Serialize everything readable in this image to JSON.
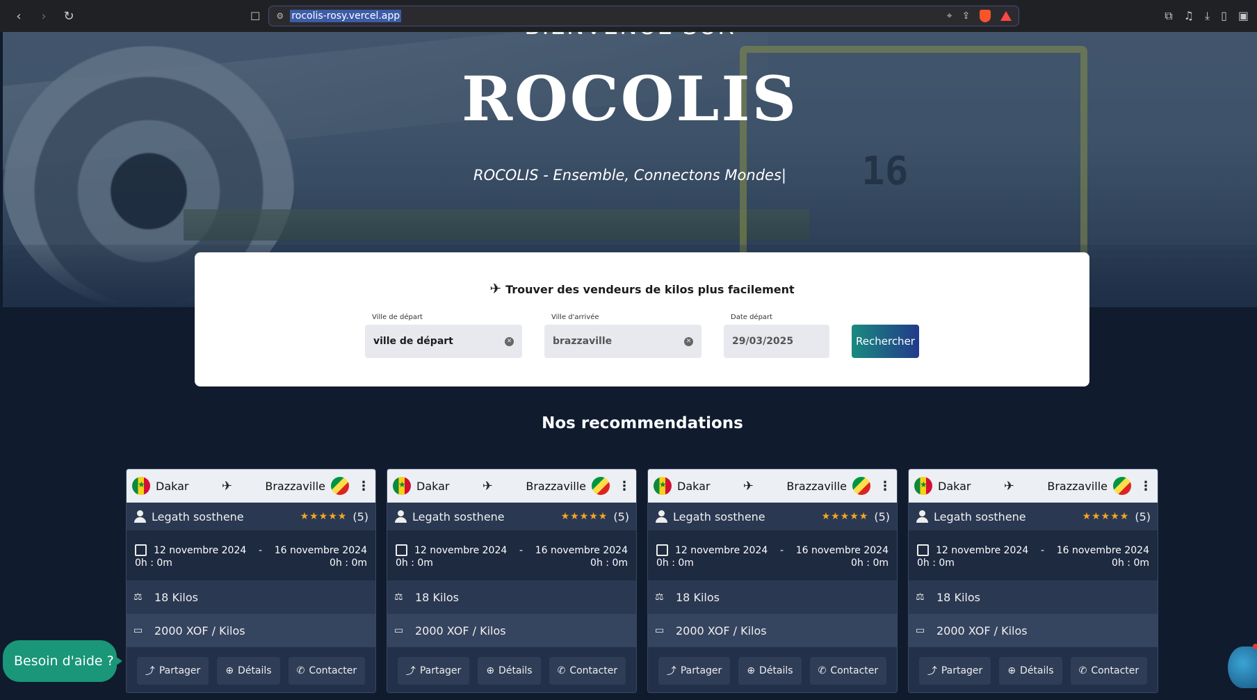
{
  "browser": {
    "url": "rocolis-rosy.vercel.app",
    "nav": {
      "back": "‹",
      "forward": "›",
      "reload": "↻"
    }
  },
  "hero": {
    "heading_top": "BIENVENUE SUR",
    "brand": "ROCOLIS",
    "tagline": "ROCOLIS - Ensemble, Connectons Mondes|"
  },
  "search": {
    "title": "Trouver des vendeurs de kilos plus facilement",
    "departure": {
      "label": "Ville de départ",
      "value": "ville de départ"
    },
    "arrival": {
      "label": "Ville d'arrivée",
      "value": "brazzaville"
    },
    "date": {
      "label": "Date départ",
      "value": "29/03/2025"
    },
    "submit_label": "Rechercher"
  },
  "recommendations": {
    "title": "Nos recommendations",
    "cards": [
      {
        "from": "Dakar",
        "to": "Brazzaville",
        "seller": "Legath sosthene",
        "stars": "★★★★★",
        "rating_count": "(5)",
        "start_date": "12 novembre 2024",
        "end_date": "16 novembre 2024",
        "start_time": "0h : 0m",
        "end_time": "0h : 0m",
        "weight": "18 Kilos",
        "price": "2000 XOF / Kilos",
        "share": "Partager",
        "details": "Détails",
        "contact": "Contacter"
      },
      {
        "from": "Dakar",
        "to": "Brazzaville",
        "seller": "Legath sosthene",
        "stars": "★★★★★",
        "rating_count": "(5)",
        "start_date": "12 novembre 2024",
        "end_date": "16 novembre 2024",
        "start_time": "0h : 0m",
        "end_time": "0h : 0m",
        "weight": "18 Kilos",
        "price": "2000 XOF / Kilos",
        "share": "Partager",
        "details": "Détails",
        "contact": "Contacter"
      },
      {
        "from": "Dakar",
        "to": "Brazzaville",
        "seller": "Legath sosthene",
        "stars": "★★★★★",
        "rating_count": "(5)",
        "start_date": "12 novembre 2024",
        "end_date": "16 novembre 2024",
        "start_time": "0h : 0m",
        "end_time": "0h : 0m",
        "weight": "18 Kilos",
        "price": "2000 XOF / Kilos",
        "share": "Partager",
        "details": "Détails",
        "contact": "Contacter"
      },
      {
        "from": "Dakar",
        "to": "Brazzaville",
        "seller": "Legath sosthene",
        "stars": "★★★★★",
        "rating_count": "(5)",
        "start_date": "12 novembre 2024",
        "end_date": "16 novembre 2024",
        "start_time": "0h : 0m",
        "end_time": "0h : 0m",
        "weight": "18 Kilos",
        "price": "2000 XOF / Kilos",
        "share": "Partager",
        "details": "Détails",
        "contact": "Contacter"
      }
    ]
  },
  "help": {
    "label": "Besoin d'aide ?"
  },
  "colors": {
    "accent": "#1a9678",
    "background": "#101b2e",
    "card": "#233049",
    "star": "#f5a623"
  }
}
